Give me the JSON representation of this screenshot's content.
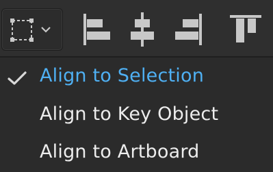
{
  "toolbar": {
    "selection_mode_icon": "dashed-selection-square-icon",
    "dropdown_icon": "chevron-down-icon",
    "tools": [
      {
        "name": "align-left-edges-icon"
      },
      {
        "name": "align-horizontal-centers-icon"
      },
      {
        "name": "align-right-edges-icon"
      },
      {
        "name": "align-top-edges-icon"
      }
    ]
  },
  "menu": {
    "items": [
      {
        "label": "Align to Selection",
        "selected": true
      },
      {
        "label": "Align to Key Object",
        "selected": false
      },
      {
        "label": "Align to Artboard",
        "selected": false
      }
    ]
  },
  "colors": {
    "background": "#2b2b2b",
    "text": "#ededed",
    "accent": "#4fb0f3",
    "icon": "#c8c8c8"
  }
}
